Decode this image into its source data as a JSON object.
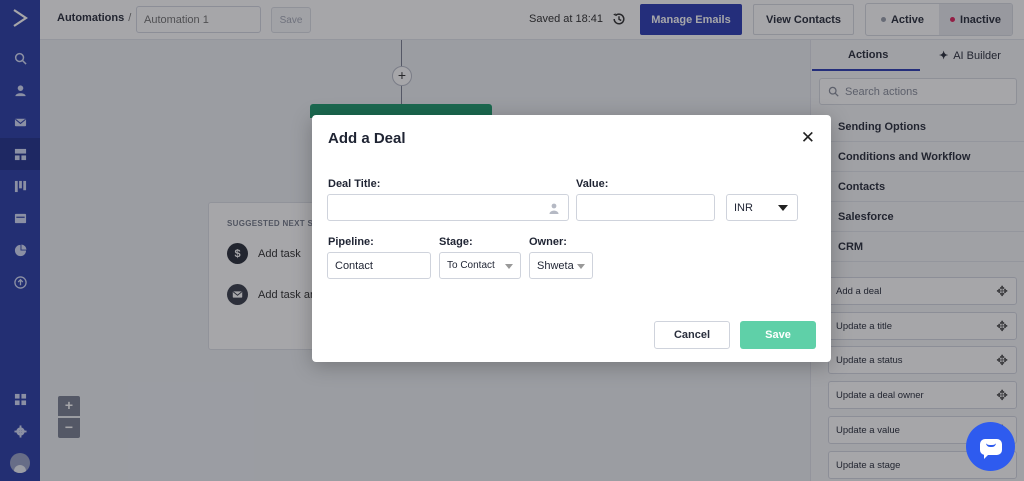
{
  "topbar": {
    "breadcrumb": "Automations",
    "automation_name_placeholder": "Automation 1",
    "save_label": "Save",
    "saved_status": "Saved at 18:41",
    "manage_emails_label": "Manage Emails",
    "view_contacts_label": "View Contacts",
    "active_label": "Active",
    "inactive_label": "Inactive",
    "active_color": "#9aa0ad",
    "inactive_color": "#e0245e"
  },
  "sidebar": {
    "icons": [
      "search-icon",
      "contacts-icon",
      "email-icon",
      "automations-icon",
      "pipeline-icon",
      "forms-icon",
      "reports-icon",
      "upload-icon"
    ],
    "bottom_icons": [
      "apps-icon",
      "settings-icon",
      "avatar"
    ]
  },
  "canvas": {
    "suggest_title": "SUGGESTED NEXT S",
    "suggest_items": [
      {
        "label": "Add task",
        "icon": "dollar-icon"
      },
      {
        "label": "Add task an",
        "icon": "email-icon"
      }
    ],
    "zoom_in": "+",
    "zoom_out": "−"
  },
  "right_panel": {
    "tab_actions": "Actions",
    "tab_ai": "AI Builder",
    "search_placeholder": "Search actions",
    "sections": [
      "Sending Options",
      "Conditions and Workflow",
      "Contacts",
      "Salesforce",
      "CRM"
    ],
    "actions": [
      "Add a deal",
      "Update a title",
      "Update a status",
      "Update a deal owner",
      "Update a value",
      "Update a stage"
    ]
  },
  "modal": {
    "title": "Add a Deal",
    "deal_title_label": "Deal Title:",
    "deal_title_value": "",
    "value_label": "Value:",
    "value_value": "",
    "currency": "INR",
    "pipeline_label": "Pipeline:",
    "pipeline_value": "Contact",
    "stage_label": "Stage:",
    "stage_value": "To Contact",
    "owner_label": "Owner:",
    "owner_value": "Shweta",
    "cancel_label": "Cancel",
    "save_label": "Save"
  },
  "colors": {
    "sidebar": "#2c3fa8",
    "primary": "#2e3eb5",
    "save_green": "#5fd0a8",
    "node_green": "#1f9c6e"
  }
}
